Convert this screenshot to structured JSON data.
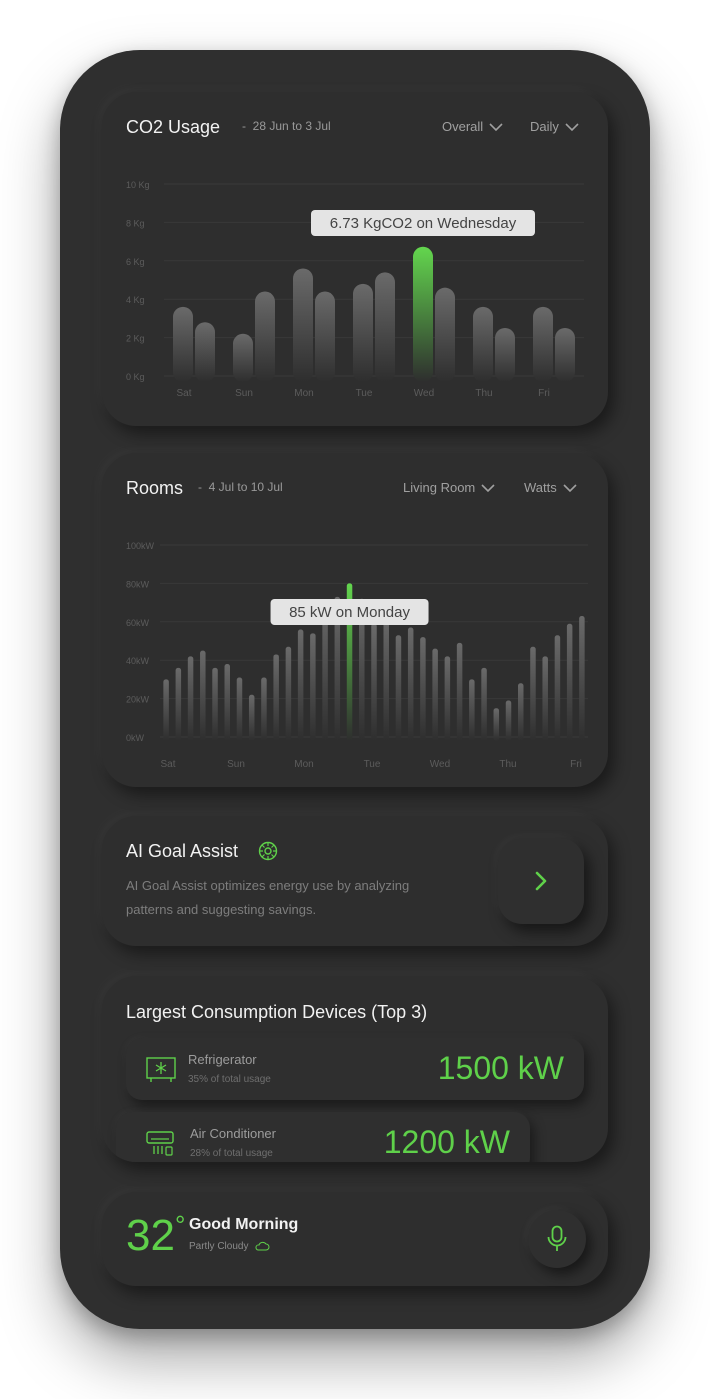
{
  "co2": {
    "title": "CO2 Usage",
    "range": "28 Jun to 3 Jul",
    "filter1": "Overall",
    "filter2": "Daily",
    "tooltip": "6.73 KgCO2 on Wednesday",
    "highlight_color": "#5fd14a",
    "chart_data": {
      "type": "bar",
      "categories": [
        "Sat",
        "Sun",
        "Mon",
        "Tue",
        "Wed",
        "Thu",
        "Fri"
      ],
      "y_ticks": [
        "0 Kg",
        "2 Kg",
        "4 Kg",
        "6 Kg",
        "8 Kg",
        "10 Kg"
      ],
      "ylim": [
        0,
        10
      ],
      "series": [
        {
          "values": [
            3.6,
            2.2,
            5.6,
            4.8,
            6.73,
            3.6,
            3.6
          ]
        },
        {
          "values": [
            2.8,
            4.4,
            4.4,
            5.4,
            4.6,
            2.5,
            2.5
          ]
        }
      ],
      "highlight": {
        "series": 0,
        "index": 4
      }
    }
  },
  "rooms": {
    "title": "Rooms",
    "range": "4 Jul to 10 Jul",
    "filter1": "Living Room",
    "filter2": "Watts",
    "tooltip": "85 kW on Monday",
    "chart_data": {
      "type": "bar",
      "x_ticks": [
        "Sat",
        "Sun",
        "Mon",
        "Tue",
        "Wed",
        "Thu",
        "Fri"
      ],
      "y_ticks": [
        "0kW",
        "20kW",
        "40kW",
        "60kW",
        "80kW",
        "100kW"
      ],
      "ylim": [
        0,
        100
      ],
      "values": [
        30,
        36,
        42,
        45,
        36,
        38,
        31,
        22,
        31,
        43,
        47,
        56,
        54,
        71,
        73,
        80,
        72,
        59,
        63,
        53,
        57,
        52,
        46,
        42,
        49,
        30,
        36,
        15,
        19,
        28,
        47,
        42,
        53,
        59,
        63
      ],
      "highlight_index": 15
    }
  },
  "ai": {
    "title": "AI Goal Assist",
    "description": "AI Goal Assist optimizes energy use by analyzing patterns and suggesting savings."
  },
  "devices": {
    "title": "Largest Consumption Devices (Top 3)",
    "items": [
      {
        "name": "Refrigerator",
        "share": "35% of total usage",
        "value": "1500 kW",
        "icon": "refrigerator-icon"
      },
      {
        "name": "Air Conditioner",
        "share": "28% of total usage",
        "value": "1200 kW",
        "icon": "air-conditioner-icon"
      }
    ]
  },
  "weather": {
    "temp": "32",
    "degree": "°",
    "greeting": "Good Morning",
    "condition": "Partly Cloudy"
  }
}
